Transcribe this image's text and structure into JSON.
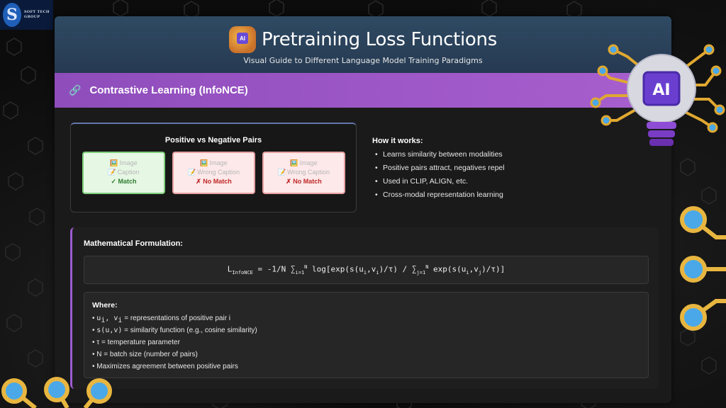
{
  "logo": {
    "mark": "S",
    "text_line1": "SOFT TECH",
    "text_line2": "GROUP"
  },
  "header": {
    "title": "Pretraining Loss Functions",
    "subtitle": "Visual Guide to Different Language Model Training Paradigms",
    "icon_label": "AI"
  },
  "section": {
    "icon": "🔗",
    "title": "Contrastive Learning (InfoNCE)"
  },
  "pairs": {
    "title": "Positive vs Negative Pairs",
    "items": [
      {
        "line1_icon": "🖼️",
        "line1": "Image",
        "line2_icon": "📝",
        "line2": "Caption",
        "verdict": "✓ Match"
      },
      {
        "line1_icon": "🖼️",
        "line1": "Image",
        "line2_icon": "📝",
        "line2": "Wrong Caption",
        "verdict": "✗ No Match"
      },
      {
        "line1_icon": "🖼️",
        "line1": "Image",
        "line2_icon": "📝",
        "line2": "Wrong Caption",
        "verdict": "✗ No Match"
      }
    ]
  },
  "how": {
    "title": "How it works:",
    "items": [
      "Learns similarity between modalities",
      "Positive pairs attract, negatives repel",
      "Used in CLIP, ALIGN, etc.",
      "Cross-modal representation learning"
    ]
  },
  "math": {
    "title": "Mathematical Formulation:",
    "formula": {
      "L": "L",
      "L_sub": "InfoNCE",
      "eq": " = -1/N ",
      "sum1": "∑",
      "sum1_sub": "i=1",
      "sum1_sup": "N",
      "log_open": " log[exp(s(u",
      "i1": "i",
      "comma1": ",v",
      "i2": "i",
      "close1": ")/τ) / ",
      "sum2": "∑",
      "sum2_sub": "j=1",
      "sum2_sup": "N",
      "exp_open": " exp(s(u",
      "i3": "i",
      "comma2": ",v",
      "j1": "j",
      "close2": ")/τ)]"
    },
    "where_title": "Where:",
    "where": [
      {
        "code": "u",
        "sub": "i",
        "code2": ", v",
        "sub2": "i",
        "text": " = representations of positive pair i"
      },
      {
        "code": "s(u,v)",
        "text": " = similarity function (e.g., cosine similarity)"
      },
      {
        "code": "",
        "text": "τ = temperature parameter"
      },
      {
        "code": "",
        "text": "N = batch size (number of pairs)"
      },
      {
        "code": "",
        "text": "Maximizes agreement between positive pairs"
      }
    ]
  },
  "colors": {
    "header_bg": "#2f4a63",
    "section_bar": "#9f58c8",
    "match_green": "#2d7d2d",
    "no_match_red": "#c02828",
    "circuit_orange": "#f0b83a",
    "circuit_blue": "#4aa8e8"
  }
}
